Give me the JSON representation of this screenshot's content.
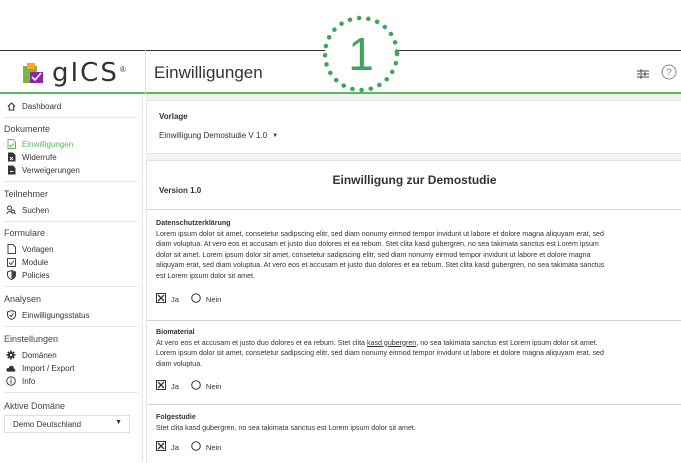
{
  "app": {
    "logo_text": "gICS",
    "logo_reg": "®",
    "page_title": "Einwilligungen",
    "callout_number": "1"
  },
  "colors": {
    "accent": "#5cb85c",
    "callout": "#3aa65a"
  },
  "sidebar": {
    "dashboard": "Dashboard",
    "sections": {
      "dokumente": "Dokumente",
      "teilnehmer": "Teilnehmer",
      "formulare": "Formulare",
      "analysen": "Analysen",
      "einstellungen": "Einstellungen",
      "aktive_domaene": "Aktive Domäne"
    },
    "items": {
      "einwilligungen": "Einwilligungen",
      "widerrufe": "Widerrufe",
      "verweigerungen": "Verweigerungen",
      "suchen": "Suchen",
      "vorlagen": "Vorlagen",
      "module": "Module",
      "policies": "Policies",
      "einwilligungsstatus": "Einwilligungsstatus",
      "domaenen": "Domänen",
      "import_export": "Import / Export",
      "info": "Info"
    },
    "domain_select": "Demo Deutschland"
  },
  "vorlage": {
    "label": "Vorlage",
    "selected": "Einwilligung Demostudie V 1.0"
  },
  "document": {
    "version": "Version 1.0",
    "title": "Einwilligung zur Demostudie",
    "sections": [
      {
        "title": "Datenschutzerklärung",
        "lines": [
          "Lorem ipsum dolor sit amet, consetetur sadipscing elitr, sed diam nonumy eirmod tempor invidunt ut labore et dolore magna aliquyam erat, sed",
          "diam voluptua. At vero eos et accusam et justo duo dolores et ea rebum. Stet clita kasd gubergren, no sea takimata sanctus est Lorem ipsum",
          "dolor sit amet. Lorem ipsum dolor sit amet, consetetur sadipscing elitr, sed diam nonumy eirmod tempor invidunt ut labore et dolore magna",
          "aliquyam erat, sed diam voluptua. At vero eos et accusam et justo duo dolores et ea rebum. Stet clita kasd gubergren, no sea takimata sanctus",
          "est Lorem ipsum dolor sit amet."
        ],
        "yes": "Ja",
        "no": "Nein"
      },
      {
        "title": "Biomaterial",
        "line1_pre": "At vero eos et accusam et justo duo dolores et ea rebum. Stet clita ",
        "line1_link": "kasd gubergren",
        "line1_post": ", no sea takimata sanctus est Lorem ipsum dolor sit amet.",
        "lines": [
          "Lorem ipsum dolor sit amet, consetetur sadipscing elitr, sed diam nonumy eirmod tempor invidunt ut labore et dolore magna aliquyam erat, sed",
          "diam voluptua."
        ],
        "yes": "Ja",
        "no": "Nein"
      },
      {
        "title": "Folgestudie",
        "lines": [
          "Stet clita kasd gubergren, no sea takimata sanctus est Lorem ipsum dolor sit amet."
        ],
        "yes": "Ja",
        "no": "Nein"
      }
    ]
  }
}
